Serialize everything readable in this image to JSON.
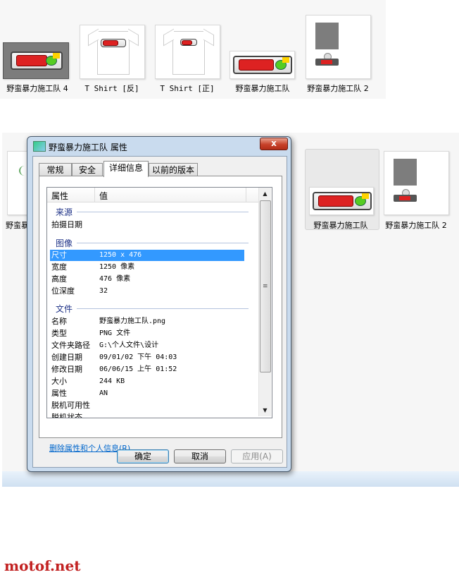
{
  "top_gallery": {
    "items": [
      {
        "caption": "野蛮暴力施工队 4"
      },
      {
        "caption": "T Shirt [反]"
      },
      {
        "caption": "T Shirt [正]"
      },
      {
        "caption": "野蛮暴力施工队"
      },
      {
        "caption": "野蛮暴力施工队 2"
      }
    ]
  },
  "bottom_gallery": {
    "items": [
      {
        "caption": "野蛮暴"
      },
      {
        "caption": "野蛮暴力施工队"
      },
      {
        "caption": "野蛮暴力施工队 2"
      }
    ]
  },
  "dialog": {
    "title": "野蛮暴力施工队 属性",
    "close_label": "x",
    "tabs": [
      {
        "label": "常规"
      },
      {
        "label": "安全"
      },
      {
        "label": "详细信息"
      },
      {
        "label": "以前的版本"
      }
    ],
    "active_tab": "详细信息",
    "columns": {
      "property": "属性",
      "value": "值"
    },
    "groups": {
      "source": "来源",
      "image": "图像",
      "file": "文件"
    },
    "source_rows": [
      {
        "key": "拍摄日期",
        "value": ""
      }
    ],
    "image_rows": [
      {
        "key": "尺寸",
        "value": "1250 x 476"
      },
      {
        "key": "宽度",
        "value": "1250 像素"
      },
      {
        "key": "高度",
        "value": "476 像素"
      },
      {
        "key": "位深度",
        "value": "32"
      }
    ],
    "file_rows": [
      {
        "key": "名称",
        "value": "野蛮暴力施工队.png"
      },
      {
        "key": "类型",
        "value": "PNG 文件"
      },
      {
        "key": "文件夹路径",
        "value": "G:\\个人文件\\设计"
      },
      {
        "key": "创建日期",
        "value": "09/01/02 下午 04:03"
      },
      {
        "key": "修改日期",
        "value": "06/06/15 上午 01:52"
      },
      {
        "key": "大小",
        "value": "244 KB"
      },
      {
        "key": "属性",
        "value": "AN"
      },
      {
        "key": "脱机可用性",
        "value": ""
      },
      {
        "key": "脱机状态",
        "value": ""
      }
    ],
    "remove_link": "删除属性和个人信息(R)",
    "buttons": {
      "ok": "确定",
      "cancel": "取消",
      "apply": "应用(A)"
    }
  },
  "watermark": "motof.net",
  "colors": {
    "selection": "#3399ff",
    "link": "#0066cc",
    "group_heading": "#1e3287",
    "watermark": "#c22121"
  }
}
